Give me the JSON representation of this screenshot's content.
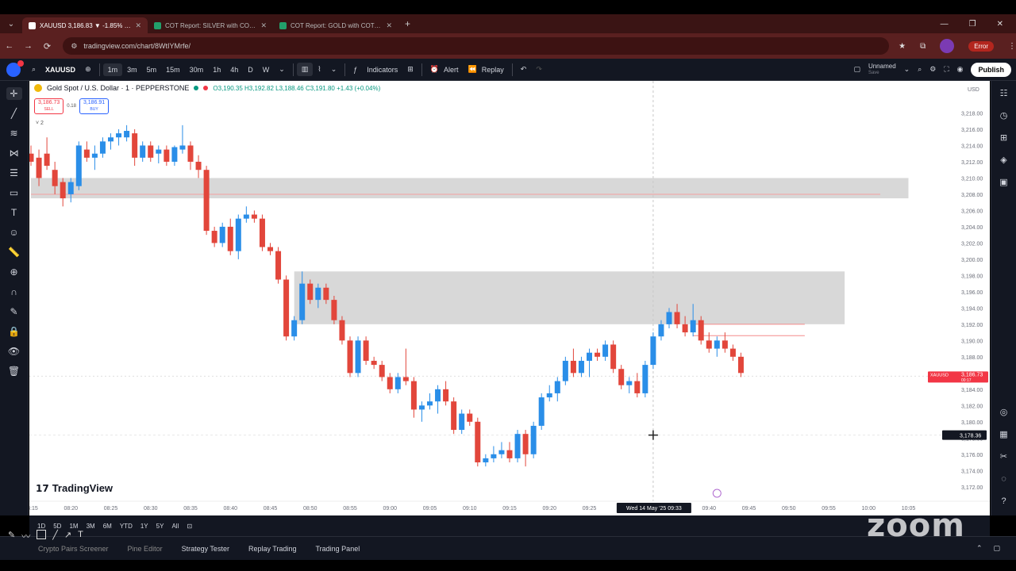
{
  "browser": {
    "tabs": [
      {
        "title": "XAUUSD 3,186.83 ▼ -1.85% U...",
        "active": true,
        "fav_color": "#ffffff"
      },
      {
        "title": "COT Report: SILVER with COT C...",
        "active": false,
        "fav_color": "#22a06b"
      },
      {
        "title": "COT Report: GOLD with COT C...",
        "active": false,
        "fav_color": "#22a06b"
      }
    ],
    "url": "tradingview.com/chart/8WtIYMrfe/",
    "profile_label": "Error"
  },
  "toolbar": {
    "symbol": "XAUUSD",
    "intervals": [
      "1m",
      "3m",
      "5m",
      "15m",
      "30m",
      "1h",
      "4h",
      "D",
      "W"
    ],
    "active_interval": "1m",
    "indicators_label": "Indicators",
    "alert_label": "Alert",
    "replay_label": "Replay",
    "layout_name": "Unnamed",
    "layout_sub": "Save",
    "publish_label": "Publish"
  },
  "legend": {
    "title": "Gold Spot / U.S. Dollar · 1 · PEPPERSTONE",
    "ohlc": "O3,190.35 H3,192.82 L3,188.46 C3,191.80 +1.43 (+0.04%)",
    "sell_price": "3,186.73",
    "sell_label": "SELL",
    "spread": "0.18",
    "buy_price": "3,186.91",
    "buy_label": "BUY",
    "collapse_label": "˅ 2"
  },
  "chart_data": {
    "type": "candlestick",
    "symbol": "XAUUSD",
    "currency": "USD",
    "ylim": [
      3171,
      3220
    ],
    "y_ticks": [
      "3,218.00",
      "3,216.00",
      "3,214.00",
      "3,212.00",
      "3,210.00",
      "3,208.00",
      "3,206.00",
      "3,204.00",
      "3,202.00",
      "3,200.00",
      "3,198.00",
      "3,196.00",
      "3,194.00",
      "3,192.00",
      "3,190.00",
      "3,188.00",
      "3,186.00",
      "3,184.00",
      "3,182.00",
      "3,180.00",
      "3,178.00",
      "3,176.00",
      "3,174.00",
      "3,172.00"
    ],
    "x_ticks": [
      "08:15",
      "08:20",
      "08:25",
      "08:30",
      "08:35",
      "08:40",
      "08:45",
      "08:50",
      "08:55",
      "09:00",
      "09:05",
      "09:10",
      "09:15",
      "09:20",
      "09:25",
      "09:30",
      "09:35",
      "09:40",
      "09:45",
      "09:50",
      "09:55",
      "10:00",
      "10:05"
    ],
    "crosshair_time_label": "Wed 14 May '25  09:33",
    "crosshair_price_label": "3,178.36",
    "current_price_label": "3,186.73",
    "current_price_sub": "00:17",
    "current_symbol_tag": "XAUUSD",
    "supply_zones": [
      {
        "start": "08:15",
        "end": "10:05",
        "top": 3210.0,
        "bottom": 3207.5,
        "line": 3208.0
      },
      {
        "start": "08:48",
        "end": "09:57",
        "top": 3198.5,
        "bottom": 3192.0
      }
    ],
    "short_lines": [
      3192.0,
      3190.6
    ],
    "candles": [
      {
        "t": "08:15",
        "o": 3213.0,
        "h": 3214.0,
        "l": 3211.5,
        "c": 3212.0
      },
      {
        "t": "08:16",
        "o": 3212.5,
        "h": 3213.5,
        "l": 3209.0,
        "c": 3210.0
      },
      {
        "t": "08:17",
        "o": 3213.0,
        "h": 3215.0,
        "l": 3211.0,
        "c": 3211.5
      },
      {
        "t": "08:18",
        "o": 3211.0,
        "h": 3212.0,
        "l": 3208.0,
        "c": 3209.0
      },
      {
        "t": "08:19",
        "o": 3209.5,
        "h": 3210.0,
        "l": 3206.5,
        "c": 3207.5
      },
      {
        "t": "08:20",
        "o": 3208.0,
        "h": 3210.0,
        "l": 3207.0,
        "c": 3209.5
      },
      {
        "t": "08:21",
        "o": 3209.0,
        "h": 3214.5,
        "l": 3208.5,
        "c": 3214.0
      },
      {
        "t": "08:22",
        "o": 3213.5,
        "h": 3214.5,
        "l": 3212.0,
        "c": 3212.5
      },
      {
        "t": "08:23",
        "o": 3212.5,
        "h": 3214.0,
        "l": 3211.0,
        "c": 3213.0
      },
      {
        "t": "08:24",
        "o": 3213.0,
        "h": 3215.0,
        "l": 3212.5,
        "c": 3214.5
      },
      {
        "t": "08:25",
        "o": 3214.5,
        "h": 3215.5,
        "l": 3213.5,
        "c": 3215.0
      },
      {
        "t": "08:26",
        "o": 3215.0,
        "h": 3216.0,
        "l": 3214.0,
        "c": 3215.5
      },
      {
        "t": "08:27",
        "o": 3215.0,
        "h": 3216.5,
        "l": 3214.5,
        "c": 3215.8
      },
      {
        "t": "08:28",
        "o": 3215.5,
        "h": 3216.0,
        "l": 3211.5,
        "c": 3212.5
      },
      {
        "t": "08:29",
        "o": 3212.5,
        "h": 3214.5,
        "l": 3212.0,
        "c": 3214.0
      },
      {
        "t": "08:30",
        "o": 3214.0,
        "h": 3214.5,
        "l": 3212.0,
        "c": 3212.5
      },
      {
        "t": "08:31",
        "o": 3213.0,
        "h": 3214.0,
        "l": 3211.8,
        "c": 3213.5
      },
      {
        "t": "08:32",
        "o": 3213.5,
        "h": 3214.0,
        "l": 3211.5,
        "c": 3212.0
      },
      {
        "t": "08:33",
        "o": 3212.0,
        "h": 3214.0,
        "l": 3211.5,
        "c": 3213.8
      },
      {
        "t": "08:34",
        "o": 3213.5,
        "h": 3216.5,
        "l": 3213.0,
        "c": 3214.0
      },
      {
        "t": "08:35",
        "o": 3214.0,
        "h": 3214.5,
        "l": 3211.0,
        "c": 3212.0
      },
      {
        "t": "08:36",
        "o": 3212.0,
        "h": 3212.8,
        "l": 3210.0,
        "c": 3211.0
      },
      {
        "t": "08:37",
        "o": 3211.0,
        "h": 3211.5,
        "l": 3203.0,
        "c": 3203.5
      },
      {
        "t": "08:38",
        "o": 3203.5,
        "h": 3204.0,
        "l": 3201.5,
        "c": 3202.0
      },
      {
        "t": "08:39",
        "o": 3202.0,
        "h": 3204.5,
        "l": 3201.5,
        "c": 3204.0
      },
      {
        "t": "08:40",
        "o": 3204.0,
        "h": 3205.0,
        "l": 3200.5,
        "c": 3201.0
      },
      {
        "t": "08:41",
        "o": 3201.0,
        "h": 3205.5,
        "l": 3200.0,
        "c": 3205.0
      },
      {
        "t": "08:42",
        "o": 3205.0,
        "h": 3206.5,
        "l": 3204.5,
        "c": 3205.5
      },
      {
        "t": "08:43",
        "o": 3205.5,
        "h": 3206.0,
        "l": 3204.5,
        "c": 3205.0
      },
      {
        "t": "08:44",
        "o": 3205.0,
        "h": 3205.5,
        "l": 3201.0,
        "c": 3201.5
      },
      {
        "t": "08:45",
        "o": 3201.5,
        "h": 3202.0,
        "l": 3200.5,
        "c": 3201.0
      },
      {
        "t": "08:46",
        "o": 3201.0,
        "h": 3201.5,
        "l": 3197.0,
        "c": 3197.5
      },
      {
        "t": "08:47",
        "o": 3197.5,
        "h": 3198.0,
        "l": 3190.0,
        "c": 3190.5
      },
      {
        "t": "08:48",
        "o": 3190.5,
        "h": 3193.0,
        "l": 3190.0,
        "c": 3192.5
      },
      {
        "t": "08:49",
        "o": 3192.5,
        "h": 3198.5,
        "l": 3192.0,
        "c": 3197.0
      },
      {
        "t": "08:50",
        "o": 3197.0,
        "h": 3197.5,
        "l": 3194.5,
        "c": 3195.0
      },
      {
        "t": "08:51",
        "o": 3195.0,
        "h": 3197.0,
        "l": 3194.0,
        "c": 3196.5
      },
      {
        "t": "08:52",
        "o": 3196.5,
        "h": 3197.0,
        "l": 3194.5,
        "c": 3195.0
      },
      {
        "t": "08:53",
        "o": 3195.0,
        "h": 3195.5,
        "l": 3192.0,
        "c": 3192.5
      },
      {
        "t": "08:54",
        "o": 3192.5,
        "h": 3193.0,
        "l": 3189.5,
        "c": 3190.0
      },
      {
        "t": "08:55",
        "o": 3190.0,
        "h": 3190.5,
        "l": 3185.5,
        "c": 3186.0
      },
      {
        "t": "08:56",
        "o": 3186.0,
        "h": 3190.5,
        "l": 3185.5,
        "c": 3190.0
      },
      {
        "t": "08:57",
        "o": 3190.0,
        "h": 3190.5,
        "l": 3187.0,
        "c": 3187.5
      },
      {
        "t": "08:58",
        "o": 3187.5,
        "h": 3188.0,
        "l": 3186.5,
        "c": 3187.0
      },
      {
        "t": "08:59",
        "o": 3187.0,
        "h": 3187.5,
        "l": 3185.0,
        "c": 3185.5
      },
      {
        "t": "09:00",
        "o": 3185.5,
        "h": 3186.0,
        "l": 3183.5,
        "c": 3184.0
      },
      {
        "t": "09:01",
        "o": 3184.0,
        "h": 3186.0,
        "l": 3183.5,
        "c": 3185.5
      },
      {
        "t": "09:02",
        "o": 3185.5,
        "h": 3189.0,
        "l": 3184.5,
        "c": 3185.0
      },
      {
        "t": "09:03",
        "o": 3185.0,
        "h": 3185.5,
        "l": 3180.5,
        "c": 3181.5
      },
      {
        "t": "09:04",
        "o": 3181.5,
        "h": 3182.5,
        "l": 3180.0,
        "c": 3182.0
      },
      {
        "t": "09:05",
        "o": 3182.0,
        "h": 3183.5,
        "l": 3181.5,
        "c": 3182.5
      },
      {
        "t": "09:06",
        "o": 3182.5,
        "h": 3184.5,
        "l": 3181.0,
        "c": 3184.0
      },
      {
        "t": "09:07",
        "o": 3184.0,
        "h": 3185.0,
        "l": 3182.0,
        "c": 3182.5
      },
      {
        "t": "09:08",
        "o": 3182.5,
        "h": 3183.0,
        "l": 3178.5,
        "c": 3179.0
      },
      {
        "t": "09:09",
        "o": 3179.0,
        "h": 3181.5,
        "l": 3178.5,
        "c": 3181.0
      },
      {
        "t": "09:10",
        "o": 3181.0,
        "h": 3181.5,
        "l": 3179.5,
        "c": 3180.0
      },
      {
        "t": "09:11",
        "o": 3180.0,
        "h": 3180.5,
        "l": 3174.5,
        "c": 3175.0
      },
      {
        "t": "09:12",
        "o": 3175.0,
        "h": 3176.0,
        "l": 3174.5,
        "c": 3175.5
      },
      {
        "t": "09:13",
        "o": 3175.5,
        "h": 3177.0,
        "l": 3175.0,
        "c": 3176.0
      },
      {
        "t": "09:14",
        "o": 3176.0,
        "h": 3177.5,
        "l": 3175.5,
        "c": 3176.5
      },
      {
        "t": "09:15",
        "o": 3176.5,
        "h": 3177.5,
        "l": 3175.0,
        "c": 3175.5
      },
      {
        "t": "09:16",
        "o": 3175.5,
        "h": 3179.0,
        "l": 3175.0,
        "c": 3178.5
      },
      {
        "t": "09:17",
        "o": 3178.5,
        "h": 3179.0,
        "l": 3174.5,
        "c": 3176.0
      },
      {
        "t": "09:18",
        "o": 3176.0,
        "h": 3180.0,
        "l": 3175.5,
        "c": 3179.5
      },
      {
        "t": "09:19",
        "o": 3179.5,
        "h": 3183.5,
        "l": 3179.0,
        "c": 3183.0
      },
      {
        "t": "09:20",
        "o": 3183.0,
        "h": 3184.5,
        "l": 3182.5,
        "c": 3183.5
      },
      {
        "t": "09:21",
        "o": 3183.5,
        "h": 3185.5,
        "l": 3182.5,
        "c": 3185.0
      },
      {
        "t": "09:22",
        "o": 3185.0,
        "h": 3188.0,
        "l": 3184.5,
        "c": 3187.5
      },
      {
        "t": "09:23",
        "o": 3187.5,
        "h": 3189.0,
        "l": 3185.5,
        "c": 3186.0
      },
      {
        "t": "09:24",
        "o": 3186.0,
        "h": 3188.0,
        "l": 3185.5,
        "c": 3187.5
      },
      {
        "t": "09:25",
        "o": 3187.5,
        "h": 3189.0,
        "l": 3185.5,
        "c": 3188.5
      },
      {
        "t": "09:26",
        "o": 3188.5,
        "h": 3189.0,
        "l": 3187.5,
        "c": 3188.0
      },
      {
        "t": "09:27",
        "o": 3188.0,
        "h": 3190.0,
        "l": 3187.5,
        "c": 3189.5
      },
      {
        "t": "09:28",
        "o": 3189.5,
        "h": 3190.0,
        "l": 3186.0,
        "c": 3186.5
      },
      {
        "t": "09:29",
        "o": 3186.5,
        "h": 3187.0,
        "l": 3184.0,
        "c": 3184.5
      },
      {
        "t": "09:30",
        "o": 3184.5,
        "h": 3185.5,
        "l": 3183.5,
        "c": 3185.0
      },
      {
        "t": "09:31",
        "o": 3185.0,
        "h": 3186.0,
        "l": 3183.0,
        "c": 3183.5
      },
      {
        "t": "09:32",
        "o": 3183.5,
        "h": 3187.5,
        "l": 3183.0,
        "c": 3187.0
      },
      {
        "t": "09:33",
        "o": 3187.0,
        "h": 3191.0,
        "l": 3186.5,
        "c": 3190.5
      },
      {
        "t": "09:34",
        "o": 3190.5,
        "h": 3192.5,
        "l": 3190.0,
        "c": 3192.0
      },
      {
        "t": "09:35",
        "o": 3192.0,
        "h": 3194.0,
        "l": 3191.5,
        "c": 3193.5
      },
      {
        "t": "09:36",
        "o": 3193.5,
        "h": 3194.5,
        "l": 3191.5,
        "c": 3192.0
      },
      {
        "t": "09:37",
        "o": 3192.0,
        "h": 3193.0,
        "l": 3190.5,
        "c": 3191.0
      },
      {
        "t": "09:38",
        "o": 3191.0,
        "h": 3194.5,
        "l": 3190.5,
        "c": 3192.5
      },
      {
        "t": "09:39",
        "o": 3192.5,
        "h": 3193.0,
        "l": 3189.5,
        "c": 3190.0
      },
      {
        "t": "09:40",
        "o": 3190.0,
        "h": 3191.0,
        "l": 3188.5,
        "c": 3189.0
      },
      {
        "t": "09:41",
        "o": 3189.0,
        "h": 3190.5,
        "l": 3188.0,
        "c": 3190.0
      },
      {
        "t": "09:42",
        "o": 3190.0,
        "h": 3191.0,
        "l": 3188.5,
        "c": 3189.0
      },
      {
        "t": "09:43",
        "o": 3189.0,
        "h": 3189.5,
        "l": 3187.5,
        "c": 3188.0
      },
      {
        "t": "09:44",
        "o": 3188.0,
        "h": 3188.5,
        "l": 3185.5,
        "c": 3186.0
      }
    ]
  },
  "bottom": {
    "ranges": [
      "1D",
      "5D",
      "1M",
      "3M",
      "6M",
      "YTD",
      "1Y",
      "5Y",
      "All"
    ],
    "panel_tabs": [
      "Crypto Pairs Screener",
      "Pine Editor",
      "Strategy Tester",
      "Replay Trading",
      "Trading Panel"
    ],
    "zoom_watermark": "zoom",
    "tv_watermark": "TradingView"
  },
  "colors": {
    "up": "#2a8ee8",
    "down": "#e2463b",
    "zone": "#d4d4d4",
    "accent": "#2962ff"
  }
}
